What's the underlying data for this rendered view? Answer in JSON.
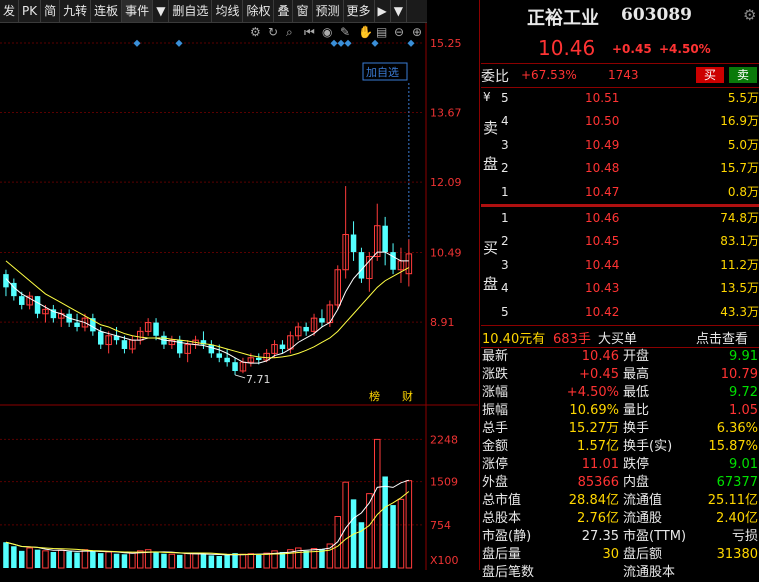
{
  "toolbar": {
    "items": [
      "发",
      "PK",
      "简",
      "九转",
      "连板",
      "事件",
      "▼",
      "删自选",
      "均线",
      "除权",
      "叠",
      "窗",
      "预测",
      "更多",
      "▶",
      "▼"
    ]
  },
  "stock": {
    "name": "正裕工业",
    "code": "603089",
    "price": "10.46",
    "change": "+0.45",
    "change_pct": "+4.50%"
  },
  "weibi": {
    "label": "委比",
    "ratio": "+67.53%",
    "diff": "1743",
    "sell_btn": "买",
    "buy_btn": "卖"
  },
  "ask_label": [
    "¥",
    "卖",
    "盘"
  ],
  "bid_label": [
    "买",
    "盘"
  ],
  "asks": [
    {
      "lvl": "5",
      "price": "10.51",
      "vol": "5.5万"
    },
    {
      "lvl": "4",
      "price": "10.50",
      "vol": "16.9万"
    },
    {
      "lvl": "3",
      "price": "10.49",
      "vol": "5.0万"
    },
    {
      "lvl": "2",
      "price": "10.48",
      "vol": "15.7万"
    },
    {
      "lvl": "1",
      "price": "10.47",
      "vol": "0.8万"
    }
  ],
  "bids": [
    {
      "lvl": "1",
      "price": "10.46",
      "vol": "74.8万"
    },
    {
      "lvl": "2",
      "price": "10.45",
      "vol": "83.1万"
    },
    {
      "lvl": "3",
      "price": "10.44",
      "vol": "11.2万"
    },
    {
      "lvl": "4",
      "price": "10.43",
      "vol": "13.5万"
    },
    {
      "lvl": "5",
      "price": "10.42",
      "vol": "43.3万"
    }
  ],
  "big_order": {
    "price": "10.40元有",
    "qty": "683手",
    "label": "大买单",
    "link": "点击查看"
  },
  "stats": [
    {
      "l": "最新",
      "v": "10.46",
      "vc": "red",
      "l2": "开盘",
      "v2": "9.91",
      "v2c": "green"
    },
    {
      "l": "涨跌",
      "v": "+0.45",
      "vc": "red",
      "l2": "最高",
      "v2": "10.79",
      "v2c": "red"
    },
    {
      "l": "涨幅",
      "v": "+4.50%",
      "vc": "red",
      "l2": "最低",
      "v2": "9.72",
      "v2c": "green"
    },
    {
      "l": "振幅",
      "v": "10.69%",
      "vc": "yellow",
      "l2": "量比",
      "v2": "1.05",
      "v2c": "red"
    },
    {
      "l": "总手",
      "v": "15.27万",
      "vc": "yellow",
      "l2": "换手",
      "v2": "6.36%",
      "v2c": "yellow"
    },
    {
      "l": "金额",
      "v": "1.57亿",
      "vc": "yellow",
      "l2": "换手(实)",
      "v2": "15.87%",
      "v2c": "yellow"
    },
    {
      "l": "涨停",
      "v": "11.01",
      "vc": "red",
      "l2": "跌停",
      "v2": "9.01",
      "v2c": "green"
    },
    {
      "l": "外盘",
      "v": "85366",
      "vc": "red",
      "l2": "内盘",
      "v2": "67377",
      "v2c": "green"
    },
    {
      "l": "总市值",
      "v": "28.84亿",
      "vc": "yellow",
      "l2": "流通值",
      "v2": "25.11亿",
      "v2c": "yellow"
    },
    {
      "l": "总股本",
      "v": "2.76亿",
      "vc": "yellow",
      "l2": "流通股",
      "v2": "2.40亿",
      "v2c": "yellow"
    },
    {
      "l": "市盈(静)",
      "v": "27.35",
      "vc": "white",
      "l2": "市盈(TTM)",
      "v2": "亏损",
      "v2c": "white"
    },
    {
      "l": "盘后量",
      "v": "30",
      "vc": "yellow",
      "l2": "盘后额",
      "v2": "31380",
      "v2c": "yellow"
    },
    {
      "l": "盘后笔数",
      "v": "",
      "vc": "yellow",
      "l2": "流通股本",
      "v2": "",
      "v2c": "yellow"
    }
  ],
  "chart_data": {
    "type": "candlestick",
    "price_axis": [
      "15.25",
      "13.67",
      "12.09",
      "10.49",
      "8.91"
    ],
    "price_ylim": [
      7.3,
      15.25
    ],
    "volume_axis": [
      "2248",
      "1509",
      "754",
      "X100"
    ],
    "volume_ylim": [
      0,
      2500
    ],
    "low_label": "7.71",
    "high_marker": "10.79",
    "add_watch_label": "加自选",
    "tags": [
      "榜",
      "财"
    ],
    "candles": [
      [
        10.0,
        10.1,
        9.5,
        9.7
      ],
      [
        9.8,
        9.9,
        9.4,
        9.5
      ],
      [
        9.5,
        9.6,
        9.2,
        9.3
      ],
      [
        9.3,
        9.6,
        9.2,
        9.5
      ],
      [
        9.5,
        9.5,
        9.0,
        9.1
      ],
      [
        9.1,
        9.3,
        8.9,
        9.2
      ],
      [
        9.2,
        9.3,
        8.9,
        9.0
      ],
      [
        9.0,
        9.2,
        8.8,
        9.1
      ],
      [
        9.1,
        9.2,
        8.8,
        8.9
      ],
      [
        8.9,
        9.1,
        8.7,
        8.8
      ],
      [
        8.8,
        9.1,
        8.7,
        9.0
      ],
      [
        9.0,
        9.1,
        8.6,
        8.7
      ],
      [
        8.7,
        8.8,
        8.3,
        8.4
      ],
      [
        8.4,
        8.7,
        8.2,
        8.6
      ],
      [
        8.6,
        8.8,
        8.4,
        8.5
      ],
      [
        8.5,
        8.6,
        8.2,
        8.3
      ],
      [
        8.3,
        8.6,
        8.2,
        8.5
      ],
      [
        8.5,
        8.8,
        8.4,
        8.7
      ],
      [
        8.7,
        9.0,
        8.6,
        8.9
      ],
      [
        8.9,
        9.0,
        8.5,
        8.6
      ],
      [
        8.6,
        8.7,
        8.3,
        8.4
      ],
      [
        8.4,
        8.6,
        8.3,
        8.5
      ],
      [
        8.5,
        8.6,
        8.1,
        8.2
      ],
      [
        8.2,
        8.5,
        8.0,
        8.4
      ],
      [
        8.4,
        8.6,
        8.3,
        8.5
      ],
      [
        8.5,
        8.7,
        8.3,
        8.4
      ],
      [
        8.4,
        8.5,
        8.1,
        8.2
      ],
      [
        8.2,
        8.4,
        8.0,
        8.1
      ],
      [
        8.1,
        8.3,
        7.9,
        8.0
      ],
      [
        8.0,
        8.1,
        7.71,
        7.8
      ],
      [
        7.8,
        8.1,
        7.75,
        8.0
      ],
      [
        8.0,
        8.2,
        7.9,
        8.1
      ],
      [
        8.1,
        8.2,
        7.95,
        8.05
      ],
      [
        8.05,
        8.3,
        8.0,
        8.2
      ],
      [
        8.2,
        8.5,
        8.1,
        8.4
      ],
      [
        8.4,
        8.5,
        8.2,
        8.3
      ],
      [
        8.3,
        8.7,
        8.2,
        8.6
      ],
      [
        8.6,
        8.9,
        8.5,
        8.8
      ],
      [
        8.8,
        8.9,
        8.6,
        8.7
      ],
      [
        8.7,
        9.1,
        8.6,
        9.0
      ],
      [
        9.0,
        9.2,
        8.8,
        8.9
      ],
      [
        8.9,
        9.4,
        8.8,
        9.3
      ],
      [
        9.3,
        10.2,
        9.2,
        10.1
      ],
      [
        10.1,
        12.0,
        9.9,
        10.9
      ],
      [
        10.9,
        11.2,
        10.3,
        10.5
      ],
      [
        10.5,
        10.6,
        9.8,
        9.9
      ],
      [
        9.9,
        10.5,
        9.6,
        10.4
      ],
      [
        10.4,
        11.6,
        10.3,
        11.1
      ],
      [
        11.1,
        11.3,
        10.2,
        10.5
      ],
      [
        10.5,
        10.7,
        10.0,
        10.1
      ],
      [
        10.1,
        10.6,
        9.8,
        10.3
      ],
      [
        10.01,
        10.79,
        9.72,
        10.46
      ]
    ],
    "volumes": [
      450,
      380,
      300,
      350,
      320,
      300,
      280,
      310,
      290,
      270,
      320,
      300,
      260,
      280,
      250,
      240,
      260,
      300,
      320,
      280,
      250,
      240,
      230,
      260,
      250,
      240,
      220,
      210,
      230,
      260,
      240,
      250,
      230,
      260,
      300,
      280,
      320,
      350,
      300,
      340,
      330,
      420,
      900,
      1500,
      1200,
      800,
      1300,
      2248,
      1600,
      1100,
      1200,
      1527
    ],
    "ma5": [
      9.9,
      9.7,
      9.55,
      9.45,
      9.35,
      9.25,
      9.15,
      9.1,
      9.0,
      8.95,
      8.9,
      8.8,
      8.7,
      8.65,
      8.6,
      8.55,
      8.5,
      8.5,
      8.55,
      8.55,
      8.5,
      8.48,
      8.45,
      8.42,
      8.4,
      8.38,
      8.33,
      8.28,
      8.2,
      8.1,
      8.0,
      7.98,
      7.98,
      8.03,
      8.15,
      8.2,
      8.3,
      8.45,
      8.55,
      8.65,
      8.8,
      8.9,
      9.2,
      9.6,
      9.9,
      10.1,
      10.3,
      10.5,
      10.5,
      10.4,
      10.3,
      10.3
    ],
    "ma10": [
      10.3,
      10.15,
      10.0,
      9.85,
      9.7,
      9.55,
      9.45,
      9.35,
      9.25,
      9.15,
      9.05,
      8.95,
      8.85,
      8.8,
      8.72,
      8.65,
      8.6,
      8.57,
      8.55,
      8.55,
      8.55,
      8.52,
      8.5,
      8.48,
      8.45,
      8.42,
      8.4,
      8.35,
      8.3,
      8.25,
      8.2,
      8.15,
      8.12,
      8.1,
      8.1,
      8.12,
      8.15,
      8.2,
      8.27,
      8.35,
      8.45,
      8.55,
      8.7,
      8.9,
      9.1,
      9.3,
      9.5,
      9.7,
      9.85,
      9.95,
      10.05,
      10.15
    ]
  }
}
